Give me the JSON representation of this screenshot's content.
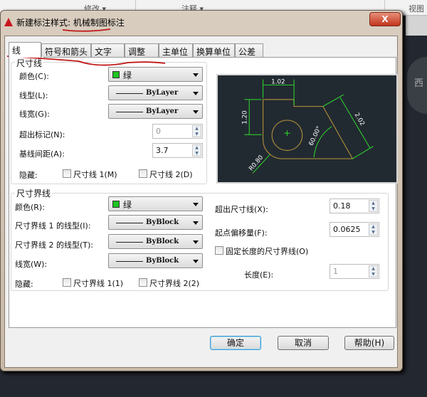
{
  "background": {
    "ribbon": {
      "modify": "修改 ▾",
      "annotate": "注释 ▾",
      "view": "视图"
    },
    "viewcube_label": "西"
  },
  "dialog": {
    "title": "新建标注样式: 机械制图标注",
    "close_label": "X",
    "tabs": [
      {
        "label": "线",
        "active": true
      },
      {
        "label": "符号和箭头"
      },
      {
        "label": "文字"
      },
      {
        "label": "调整"
      },
      {
        "label": "主单位"
      },
      {
        "label": "换算单位"
      },
      {
        "label": "公差"
      }
    ],
    "dim_lines": {
      "group_label": "尺寸线",
      "color_label": "颜色(C):",
      "color_value": "绿",
      "color_hex": "#1fc31f",
      "linetype_label": "线型(L):",
      "linetype_value": "ByLayer",
      "lineweight_label": "线宽(G):",
      "lineweight_value": "ByLayer",
      "extend_ticks_label": "超出标记(N):",
      "extend_ticks_value": "0",
      "baseline_spacing_label": "基线间距(A):",
      "baseline_spacing_value": "3.7",
      "suppress_label": "隐藏:",
      "suppress_1": "尺寸线 1(M)",
      "suppress_2": "尺寸线 2(D)"
    },
    "ext_lines": {
      "group_label": "尺寸界线",
      "color_label": "颜色(R):",
      "color_value": "绿",
      "linetype1_label": "尺寸界线 1 的线型(I):",
      "linetype1_value": "ByBlock",
      "linetype2_label": "尺寸界线 2 的线型(T):",
      "linetype2_value": "ByBlock",
      "lineweight_label": "线宽(W):",
      "lineweight_value": "ByBlock",
      "suppress_label": "隐藏:",
      "suppress_1": "尺寸界线 1(1)",
      "suppress_2": "尺寸界线 2(2)",
      "extend_beyond_label": "超出尺寸线(X):",
      "extend_beyond_value": "0.18",
      "offset_label": "起点偏移量(F):",
      "offset_value": "0.0625",
      "fixed_length_label": "固定长度的尺寸界线(O)",
      "length_label": "长度(E):",
      "length_value": "1"
    },
    "preview": {
      "dim_top": "1.02",
      "dim_left": "1.20",
      "dim_diag": "2.02",
      "dim_angle": "60.00°",
      "dim_radius": "R0.80"
    },
    "buttons": {
      "ok": "确定",
      "cancel": "取消",
      "help": "帮助(H)"
    }
  }
}
